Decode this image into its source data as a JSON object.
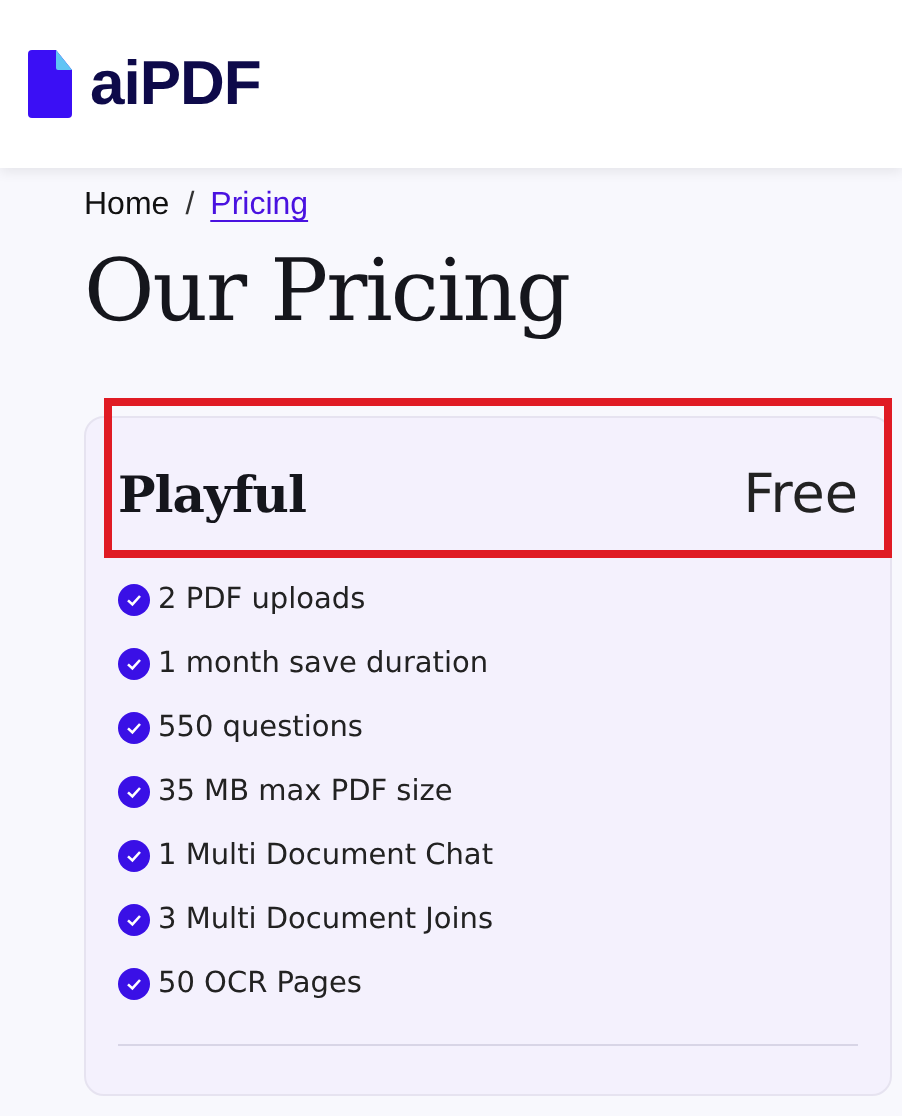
{
  "header": {
    "logo_text": "aiPDF"
  },
  "breadcrumb": [
    {
      "label": "Home",
      "selected": false
    },
    {
      "label": "Pricing",
      "selected": true
    }
  ],
  "breadcrumb_separator": "/",
  "title": "Our Pricing",
  "plan": {
    "name": "Playful",
    "price": "Free",
    "highlighted": true,
    "features": [
      "2 PDF uploads",
      "1 month save duration",
      "550 questions",
      "35 MB max PDF size",
      "1 Multi Document Chat",
      "3 Multi Document Joins",
      "50 OCR Pages"
    ]
  }
}
